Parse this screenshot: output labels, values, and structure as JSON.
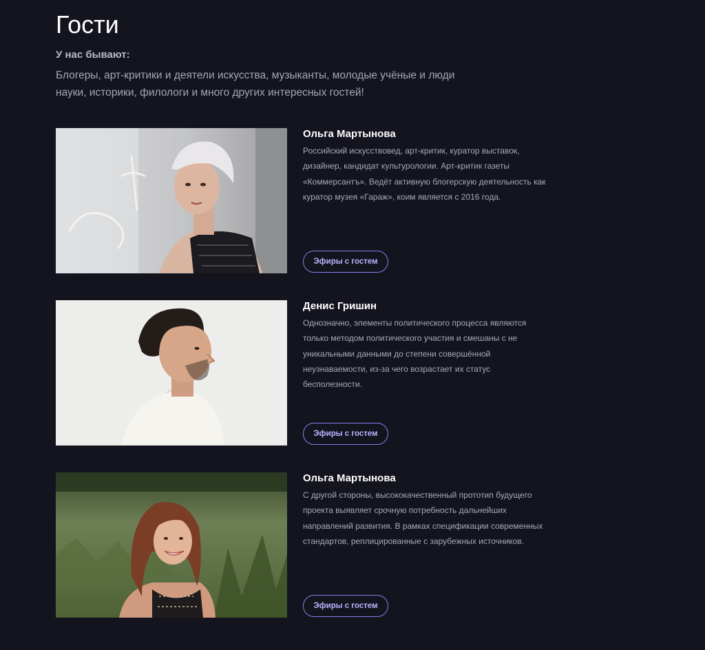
{
  "page": {
    "title": "Гости",
    "intro_heading": "У нас бывают:",
    "intro_text": "Блогеры, арт-критики и деятели искусства, музыканты, молодые учёные и люди науки, историки, филологи и много других интересных гостей!"
  },
  "colors": {
    "background": "#13141e",
    "accent": "#8a7ef0",
    "accent_text": "#b9b3ff"
  },
  "guests": [
    {
      "name": "Ольга Мартынова",
      "bio": "Российский искусствовед, арт-критик, куратор выставок, дизайнер, кандидат культурологии. Арт-критик газеты «Коммерсантъ». Ведёт активную блогерскую деятельность как куратор музея «Гараж», коим является с 2016 года.",
      "button_label": "Эфиры с гостем"
    },
    {
      "name": "Денис Гришин",
      "bio": "Однозначно, элементы политического процесса являются только методом политического участия и смешаны с не уникальными данными до степени совершённой неузнаваемости, из-за чего возрастает их статус бесполезности.",
      "button_label": "Эфиры с гостем"
    },
    {
      "name": "Ольга Мартынова",
      "bio": "С другой стороны, высококачественный прототип будущего проекта выявляет срочную потребность дальнейших направлений развития. В рамках спецификации современных стандартов, реплицированные с зарубежных источников.",
      "button_label": "Эфиры с гостем"
    }
  ]
}
